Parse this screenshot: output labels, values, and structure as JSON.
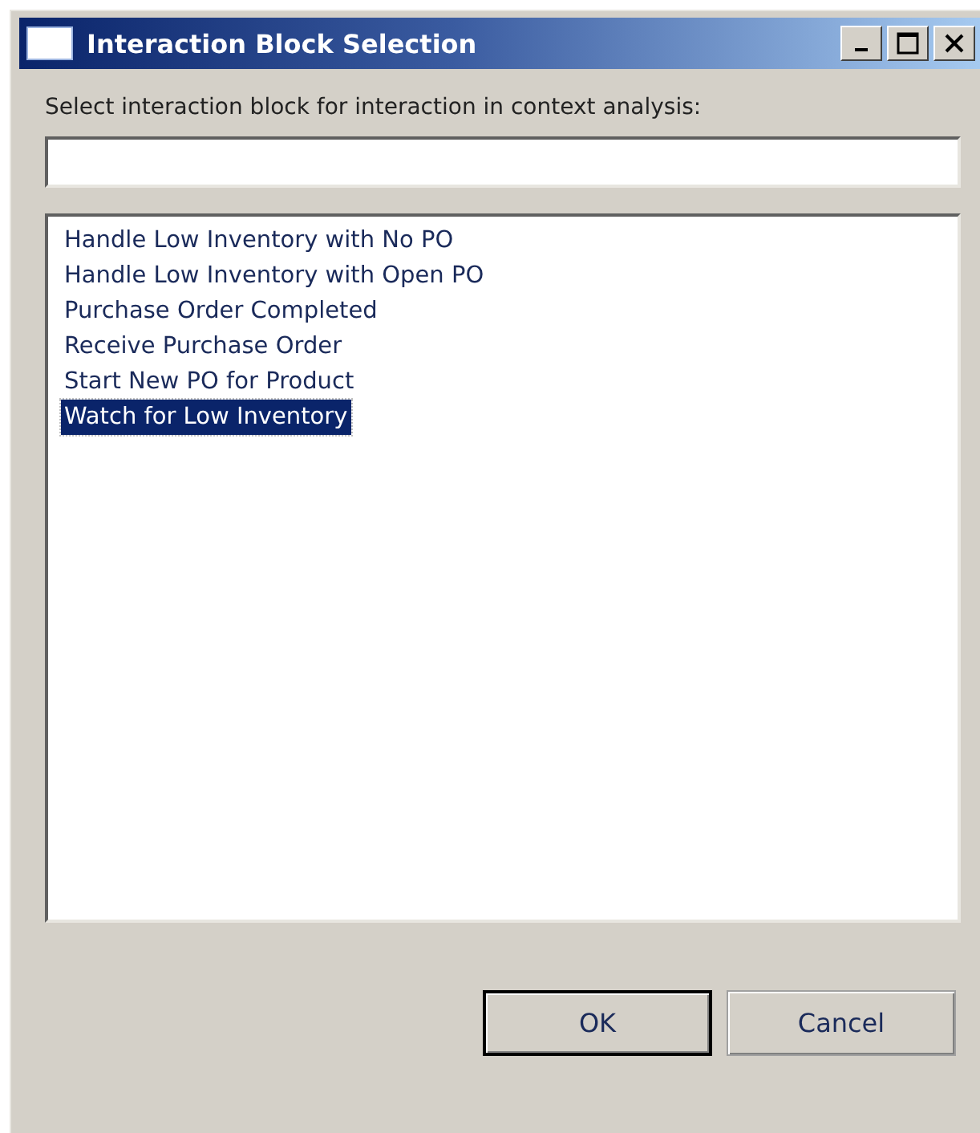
{
  "window": {
    "title": "Interaction Block Selection"
  },
  "prompt": "Select interaction block for interaction in context analysis:",
  "items": [
    {
      "label": "Handle Low Inventory with No PO",
      "selected": false
    },
    {
      "label": "Handle Low Inventory with Open PO",
      "selected": false
    },
    {
      "label": "Purchase Order Completed",
      "selected": false
    },
    {
      "label": "Receive Purchase Order",
      "selected": false
    },
    {
      "label": "Start New PO for Product",
      "selected": false
    },
    {
      "label": "Watch for Low Inventory",
      "selected": true
    }
  ],
  "buttons": [
    {
      "label": "OK",
      "default": true
    },
    {
      "label": "Cancel",
      "default": false
    }
  ]
}
